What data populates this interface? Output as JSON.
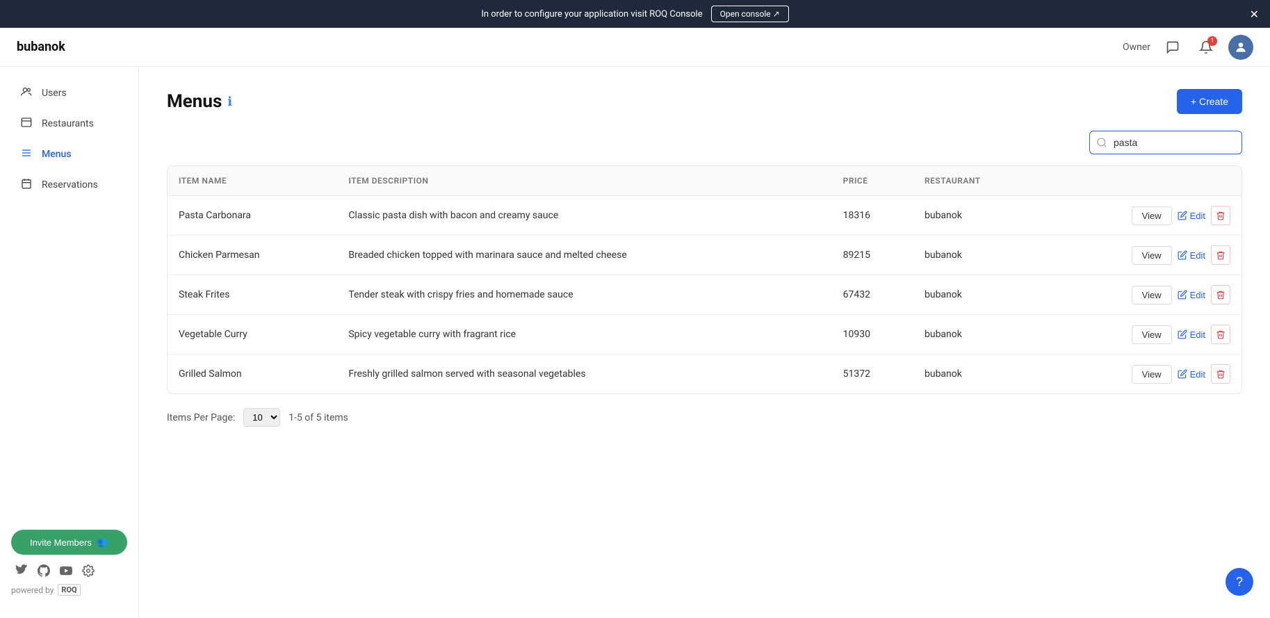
{
  "banner": {
    "message": "In order to configure your application visit ROQ Console",
    "button_label": "Open console ↗"
  },
  "header": {
    "logo": "bubanok",
    "owner_label": "Owner",
    "notification_count": "1"
  },
  "sidebar": {
    "items": [
      {
        "id": "users",
        "label": "Users",
        "icon": "👤"
      },
      {
        "id": "restaurants",
        "label": "Restaurants",
        "icon": "🍽"
      },
      {
        "id": "menus",
        "label": "Menus",
        "icon": "☰",
        "active": true
      },
      {
        "id": "reservations",
        "label": "Reservations",
        "icon": "📅"
      }
    ],
    "invite_button": "Invite Members",
    "powered_by": "powered by"
  },
  "page": {
    "title": "Menus",
    "create_button": "+ Create",
    "search_placeholder": "pasta",
    "search_value": "pasta"
  },
  "table": {
    "columns": [
      {
        "id": "item_name",
        "label": "ITEM NAME"
      },
      {
        "id": "item_description",
        "label": "ITEM DESCRIPTION"
      },
      {
        "id": "price",
        "label": "PRICE"
      },
      {
        "id": "restaurant",
        "label": "RESTAURANT"
      },
      {
        "id": "actions",
        "label": ""
      }
    ],
    "rows": [
      {
        "item_name": "Pasta Carbonara",
        "item_description": "Classic pasta dish with bacon and creamy sauce",
        "price": "18316",
        "restaurant": "bubanok"
      },
      {
        "item_name": "Chicken Parmesan",
        "item_description": "Breaded chicken topped with marinara sauce and melted cheese",
        "price": "89215",
        "restaurant": "bubanok"
      },
      {
        "item_name": "Steak Frites",
        "item_description": "Tender steak with crispy fries and homemade sauce",
        "price": "67432",
        "restaurant": "bubanok"
      },
      {
        "item_name": "Vegetable Curry",
        "item_description": "Spicy vegetable curry with fragrant rice",
        "price": "10930",
        "restaurant": "bubanok"
      },
      {
        "item_name": "Grilled Salmon",
        "item_description": "Freshly grilled salmon served with seasonal vegetables",
        "price": "51372",
        "restaurant": "bubanok"
      }
    ],
    "view_label": "View",
    "edit_label": "Edit"
  },
  "pagination": {
    "items_per_page_label": "Items Per Page:",
    "per_page_value": "10",
    "summary": "1-5 of 5 items"
  }
}
